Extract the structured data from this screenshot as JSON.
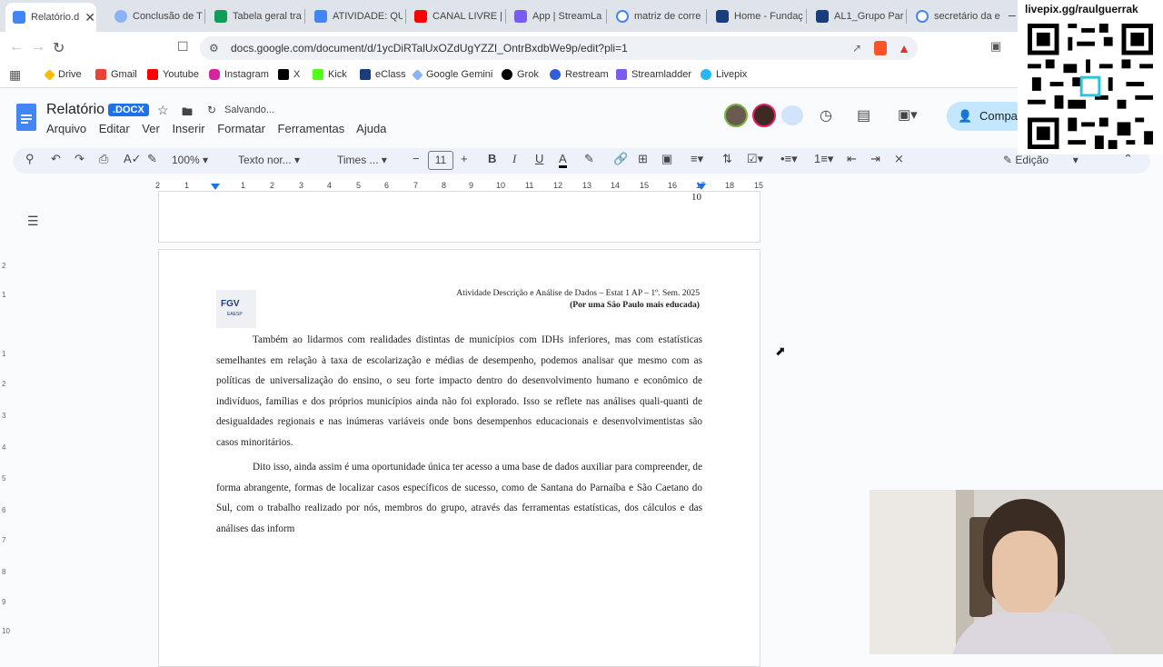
{
  "tabs": [
    {
      "label": "Relatório.d",
      "active": true,
      "icon": "docs-icon",
      "color": "#4285f4"
    },
    {
      "label": "Conclusão de T",
      "icon": "gemini-icon",
      "color": "#8ab4f8"
    },
    {
      "label": "Tabela geral tra",
      "icon": "sheets-icon",
      "color": "#0f9d58"
    },
    {
      "label": "ATIVIDADE: QU",
      "icon": "docs-icon",
      "color": "#4285f4"
    },
    {
      "label": "CANAL LIVRE |",
      "icon": "youtube-icon",
      "color": "#ff0000"
    },
    {
      "label": "App | StreamLa",
      "icon": "streamladder-icon",
      "color": "#7b5cf0"
    },
    {
      "label": "matriz de corre",
      "icon": "google-icon",
      "color": "#4285f4"
    },
    {
      "label": "Home - Fundaç",
      "icon": "fgv-icon",
      "color": "#1a3d7c"
    },
    {
      "label": "AL1_Grupo Par",
      "icon": "fgv-icon",
      "color": "#1a3d7c"
    },
    {
      "label": "secretário da e",
      "icon": "google-icon",
      "color": "#4285f4"
    }
  ],
  "tab_overflow": "–",
  "tab_close": "✕",
  "address": {
    "url": "docs.google.com/document/d/1ycDiRTalUxOZdUgYZZI_OntrBxdbWe9p/edit?pli=1"
  },
  "bookmarks": [
    {
      "label": "Drive",
      "icon": "drive-icon",
      "color": "#fbbc04"
    },
    {
      "label": "Gmail",
      "icon": "gmail-icon",
      "color": "#ea4335"
    },
    {
      "label": "Youtube",
      "icon": "youtube-icon",
      "color": "#ff0000"
    },
    {
      "label": "Instagram",
      "icon": "instagram-icon",
      "color": "#d6249f"
    },
    {
      "label": "X",
      "icon": "x-icon",
      "color": "#000000"
    },
    {
      "label": "Kick",
      "icon": "kick-icon",
      "color": "#53fc18"
    },
    {
      "label": "eClass",
      "icon": "eclass-icon",
      "color": "#1a3d7c"
    },
    {
      "label": "Google Gemini",
      "icon": "gemini-icon",
      "color": "#8ab4f8"
    },
    {
      "label": "Grok",
      "icon": "grok-icon",
      "color": "#000000"
    },
    {
      "label": "Restream",
      "icon": "restream-icon",
      "color": "#2f5fd8"
    },
    {
      "label": "Streamladder",
      "icon": "streamladder-icon",
      "color": "#7b5cf0"
    },
    {
      "label": "Livepix",
      "icon": "livepix-icon",
      "color": "#29b6f6"
    }
  ],
  "doc": {
    "title": "Relatório",
    "badge": ".DOCX",
    "status": "Salvando...",
    "share_label": "Compar",
    "menus": [
      "Arquivo",
      "Editar",
      "Ver",
      "Inserir",
      "Formatar",
      "Ferramentas",
      "Ajuda"
    ]
  },
  "toolbar": {
    "zoom": "100%",
    "style": "Texto nor...",
    "font": "Times ...",
    "font_size": "11",
    "mode": "Edição"
  },
  "ruler_numbers": [
    "2",
    "1",
    "1",
    "2",
    "3",
    "4",
    "5",
    "6",
    "7",
    "8",
    "9",
    "10",
    "11",
    "12",
    "13",
    "14",
    "15",
    "16",
    "17",
    "18",
    "15"
  ],
  "left_ruler_numbers": [
    "2",
    "1",
    "1",
    "2",
    "3",
    "4",
    "5",
    "6",
    "7",
    "8",
    "9",
    "10"
  ],
  "page_prev_number": "10",
  "page": {
    "logo_text": "FGV",
    "logo_sub": "EAESP",
    "header_line1": "Atividade Descrição e Análise de Dados – Estat 1 AP – 1º. Sem. 2025",
    "header_line2": "(Por uma São Paulo mais educada)",
    "para1": "Também ao lidarmos com realidades distintas de municípios com IDHs inferiores, mas com estatísticas semelhantes em relação à taxa de escolarização e médias de desempenho, podemos analisar que mesmo com as políticas de universalização do ensino, o seu forte impacto dentro do desenvolvimento humano e econômico de indivíduos, famílias e dos próprios municípios ainda não foi explorado. Isso se reflete nas análises quali-quanti de desigualdades regionais e nas inúmeras variáveis onde bons desempenhos educacionais e desenvolvimentistas são casos minoritários.",
    "para2": "Dito isso, ainda assim é uma oportunidade única ter acesso a uma base de dados auxiliar para compreender, de forma abrangente, formas de localizar casos específicos de sucesso, como de Santana do Parnaíba e São Caetano do Sul, com o trabalho realizado por nós, membros do grupo, através das ferramentas estatísticas, dos cálculos e das análises das inform"
  },
  "overlay": {
    "livepix_text": "livepix.gg/raulguerrak"
  },
  "colors": {
    "accent": "#1a73e8",
    "tabbar": "#dfe3ea",
    "toolbar": "#edf2fa"
  }
}
